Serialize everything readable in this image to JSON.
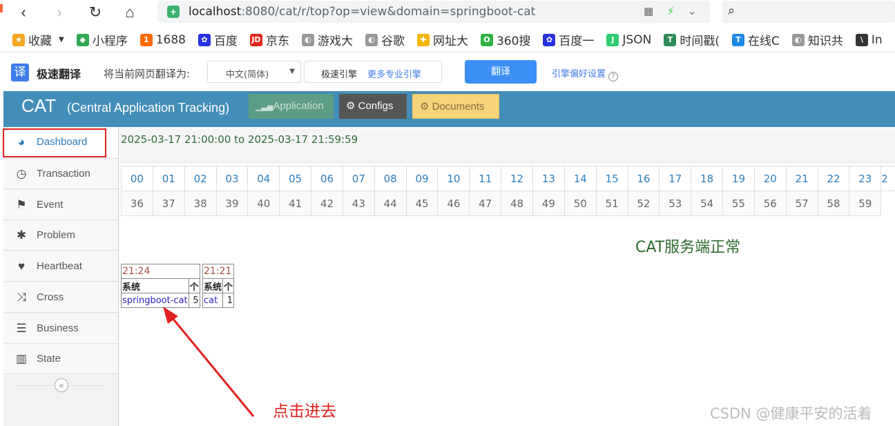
{
  "browser": {
    "url_host": "localhost",
    "url_rest": ":8080/cat/r/top?op=view&domain=springboot-cat"
  },
  "bookmarks": [
    {
      "label": "收藏",
      "color": "#f5a623",
      "glyph": "★"
    },
    {
      "label": "小程序",
      "color": "#34a853",
      "glyph": "◆"
    },
    {
      "label": "1688",
      "color": "#ff6a00",
      "glyph": "1"
    },
    {
      "label": "百度",
      "color": "#2932e1",
      "glyph": "✿"
    },
    {
      "label": "京东",
      "color": "#e1251b",
      "glyph": "JD"
    },
    {
      "label": "游戏大",
      "color": "#999999",
      "glyph": "◐"
    },
    {
      "label": "谷歌",
      "color": "#999999",
      "glyph": "◐"
    },
    {
      "label": "网址大",
      "color": "#f4b400",
      "glyph": "✚"
    },
    {
      "label": "360搜",
      "color": "#2fb344",
      "glyph": "O"
    },
    {
      "label": "百度一",
      "color": "#2932e1",
      "glyph": "✿"
    },
    {
      "label": "JSON",
      "color": "#2ecc71",
      "glyph": "J"
    },
    {
      "label": "时间戳(",
      "color": "#2e8b57",
      "glyph": "T"
    },
    {
      "label": "在线C",
      "color": "#1e88e5",
      "glyph": "T"
    },
    {
      "label": "知识共",
      "color": "#999999",
      "glyph": "◐"
    },
    {
      "label": "In",
      "color": "#333333",
      "glyph": "\\"
    }
  ],
  "translate": {
    "logo": "译",
    "title": "极速翻译",
    "label": "将当前网页翻译为:",
    "language": "中文(简体)",
    "engine": "极速引擎",
    "more_engines": "更多专业引擎",
    "translate_button": "翻译",
    "preferences": "引擎偏好设置",
    "help": "?"
  },
  "header": {
    "logo": "CAT",
    "subtitle_open": "(",
    "subtitle": "Central Application Tracking",
    "subtitle_close": ")",
    "app_button": "Application",
    "configs_button": "Configs",
    "documents_button": "Documents"
  },
  "sidebar": {
    "items": [
      {
        "label": "Dashboard",
        "icon": "dashboard-icon",
        "glyph": "◕"
      },
      {
        "label": "Transaction",
        "icon": "clock-icon",
        "glyph": "◷"
      },
      {
        "label": "Event",
        "icon": "flag-icon",
        "glyph": "⚑"
      },
      {
        "label": "Problem",
        "icon": "bug-icon",
        "glyph": "✱"
      },
      {
        "label": "Heartbeat",
        "icon": "heart-icon",
        "glyph": "♥"
      },
      {
        "label": "Cross",
        "icon": "shuffle-icon",
        "glyph": "⤨"
      },
      {
        "label": "Business",
        "icon": "list-icon",
        "glyph": "☰"
      },
      {
        "label": "State",
        "icon": "bar-chart-icon",
        "glyph": "▥"
      }
    ],
    "collapse": "«"
  },
  "main": {
    "time_range": "2025-03-17 21:00:00 to 2025-03-17 21:59:59",
    "minutes_row1": [
      "00",
      "01",
      "02",
      "03",
      "04",
      "05",
      "06",
      "07",
      "08",
      "09",
      "10",
      "11",
      "12",
      "13",
      "14",
      "15",
      "16",
      "17",
      "18",
      "19",
      "20",
      "21",
      "22",
      "23",
      "2"
    ],
    "minutes_row2": [
      "36",
      "37",
      "38",
      "39",
      "40",
      "41",
      "42",
      "43",
      "44",
      "45",
      "46",
      "47",
      "48",
      "49",
      "50",
      "51",
      "52",
      "53",
      "54",
      "55",
      "56",
      "57",
      "58",
      "59"
    ],
    "status": "CAT服务端正常",
    "top_tables": [
      {
        "time": "21:24",
        "col_system": "系统",
        "col_count": "个",
        "system": "springboot-cat",
        "count": "5"
      },
      {
        "time": "21:21",
        "col_system": "系统",
        "col_count": "个",
        "system": "cat",
        "count": "1"
      }
    ]
  },
  "annotation": "点击进去",
  "watermark": "CSDN @健康平安的活着"
}
